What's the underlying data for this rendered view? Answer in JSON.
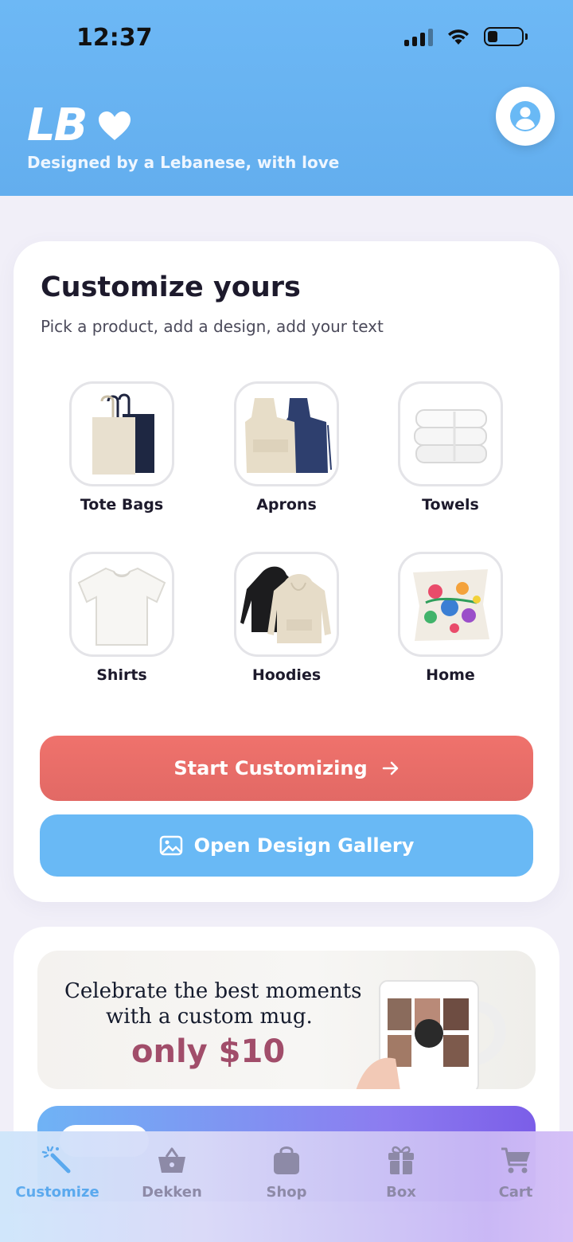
{
  "status_bar": {
    "time": "12:37"
  },
  "header": {
    "logo_text": "LB",
    "tagline": "Designed by a Lebanese, with love"
  },
  "customize": {
    "title": "Customize yours",
    "subtitle": "Pick a product, add a design, add your text",
    "products": [
      {
        "label": "Tote Bags",
        "icon": "tote-bag-image"
      },
      {
        "label": "Aprons",
        "icon": "apron-image"
      },
      {
        "label": "Towels",
        "icon": "towel-image"
      },
      {
        "label": "Shirts",
        "icon": "shirt-image"
      },
      {
        "label": "Hoodies",
        "icon": "hoodie-image"
      },
      {
        "label": "Home",
        "icon": "pillow-image"
      }
    ],
    "start_button": "Start Customizing",
    "gallery_button": "Open Design Gallery"
  },
  "promo": {
    "line1": "Celebrate the best moments",
    "line2": "with a custom mug.",
    "price": "only $10"
  },
  "bottom_nav": {
    "items": [
      {
        "label": "Customize",
        "icon": "magic-wand-icon",
        "active": true
      },
      {
        "label": "Dekken",
        "icon": "basket-icon",
        "active": false
      },
      {
        "label": "Shop",
        "icon": "shopping-bag-icon",
        "active": false
      },
      {
        "label": "Box",
        "icon": "gift-icon",
        "active": false
      },
      {
        "label": "Cart",
        "icon": "cart-icon",
        "active": false
      }
    ]
  },
  "colors": {
    "header": "#6db8f5",
    "primary_button": "#e96e68",
    "secondary_button": "#69b9f5",
    "price": "#a14d6a",
    "active_nav": "#5aa9ee",
    "inactive_nav": "#8e8aa5"
  }
}
